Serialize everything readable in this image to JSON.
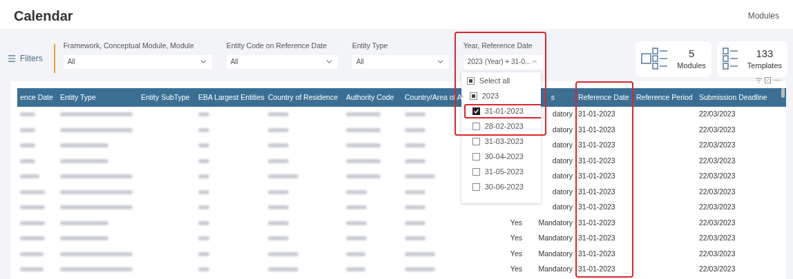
{
  "page": {
    "title": "Calendar",
    "nav_link": "Modules"
  },
  "filters": {
    "label": "Filters",
    "slicers": [
      {
        "label": "Framework, Conceptual Module, Module",
        "value": "All",
        "expanded": false,
        "highlighted": false
      },
      {
        "label": "Entity Code on Reference Date",
        "value": "All",
        "expanded": false,
        "highlighted": false
      },
      {
        "label": "Entity Type",
        "value": "All",
        "expanded": false,
        "highlighted": false
      },
      {
        "label": "Year, Reference Date",
        "value": "2023 (Year) + 31-0...",
        "expanded": true,
        "highlighted": true,
        "options": [
          {
            "label": "Select all",
            "checked": true,
            "partial": true,
            "highlighted": false
          },
          {
            "label": "2023",
            "checked": true,
            "partial": true,
            "expanded": true,
            "highlighted": false,
            "children": [
              {
                "label": "31-01-2023",
                "checked": true,
                "partial": false,
                "highlighted": true
              },
              {
                "label": "28-02-2023",
                "checked": false,
                "partial": false,
                "highlighted": false
              },
              {
                "label": "31-03-2023",
                "checked": false,
                "partial": false,
                "highlighted": false
              },
              {
                "label": "30-04-2023",
                "checked": false,
                "partial": false,
                "highlighted": false
              },
              {
                "label": "31-05-2023",
                "checked": false,
                "partial": false,
                "highlighted": false
              },
              {
                "label": "30-06-2023",
                "checked": false,
                "partial": false,
                "highlighted": false
              }
            ]
          }
        ]
      }
    ]
  },
  "cards": [
    {
      "value": "5",
      "label": "Modules",
      "kind": "modules"
    },
    {
      "value": "133",
      "label": "Templates",
      "kind": "templates"
    }
  ],
  "table": {
    "columns": [
      {
        "heading": "ence Date",
        "kind": "redacted",
        "highlighted": false
      },
      {
        "heading": "Entity Type",
        "kind": "redacted",
        "highlighted": false
      },
      {
        "heading": "Entity SubType",
        "kind": "text",
        "highlighted": false
      },
      {
        "heading": "EBA Largest Entities",
        "kind": "redacted",
        "highlighted": false
      },
      {
        "heading": "Country of Residence",
        "kind": "redacted",
        "highlighted": false
      },
      {
        "heading": "Authority Code",
        "kind": "redacted",
        "highlighted": false
      },
      {
        "heading": "Country/Area of A",
        "kind": "redacted",
        "highlighted": false
      },
      {
        "kind": "text"
      },
      {
        "heading": "s",
        "kind": "text",
        "highlighted": false
      },
      {
        "heading": "Reference Date",
        "kind": "text",
        "highlighted": true
      },
      {
        "heading": "Reference Period",
        "kind": "text",
        "highlighted": false
      },
      {
        "heading": "Submission Deadline",
        "kind": "text",
        "highlighted": false
      }
    ],
    "rows": [
      {
        "column_9": "datory",
        "reference_date": "31-01-2023",
        "submission_deadline": "22/03/2023"
      },
      {
        "column_9": "datory",
        "reference_date": "31-01-2023",
        "submission_deadline": "22/03/2023"
      },
      {
        "column_9": "datory",
        "reference_date": "31-01-2023",
        "submission_deadline": "22/03/2023"
      },
      {
        "column_9": "datory",
        "reference_date": "31-01-2023",
        "submission_deadline": "22/03/2023"
      },
      {
        "column_9": "datory",
        "reference_date": "31-01-2023",
        "submission_deadline": "22/03/2023"
      },
      {
        "column_9": "datory",
        "reference_date": "31-01-2023",
        "submission_deadline": "22/03/2023"
      },
      {
        "column_9": "datory",
        "reference_date": "31-01-2023",
        "submission_deadline": "22/03/2023"
      },
      {
        "column_8": "Yes",
        "column_9": "Mandatory",
        "reference_date": "31-01-2023",
        "submission_deadline": "22/03/2023"
      },
      {
        "column_8": "Yes",
        "column_9": "Mandatory",
        "reference_date": "31-01-2023",
        "submission_deadline": "22/03/2023"
      },
      {
        "column_8": "Yes",
        "column_9": "Mandatory",
        "reference_date": "31-01-2023",
        "submission_deadline": "22/03/2023"
      },
      {
        "column_8": "Yes",
        "column_9": "Mandatory",
        "reference_date": "31-01-2023",
        "submission_deadline": "22/03/2023"
      }
    ]
  }
}
